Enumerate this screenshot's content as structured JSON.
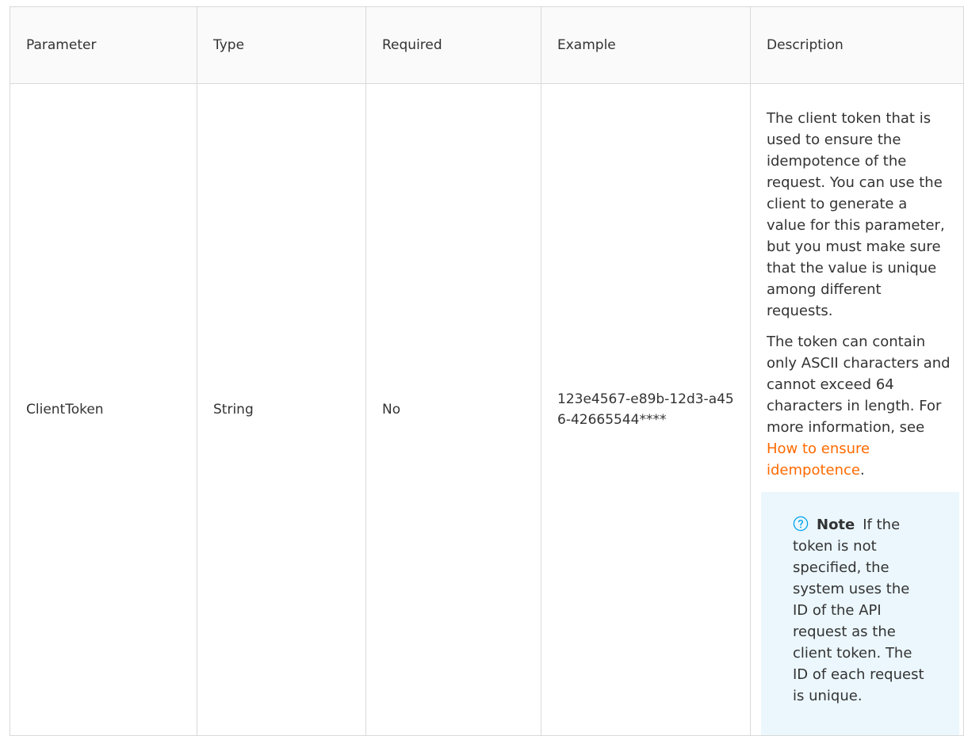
{
  "table": {
    "headers": {
      "parameter": "Parameter",
      "type": "Type",
      "required": "Required",
      "example": "Example",
      "description": "Description"
    },
    "rows": [
      {
        "parameter": "ClientToken",
        "type": "String",
        "required": "No",
        "example": "123e4567-e89b-12d3-a456-42665544****",
        "description": {
          "paragraph1": "The client token that is used to ensure the idempotence of the request. You can use the client to generate a value for this parameter, but you must make sure that the value is unique among different requests.",
          "paragraph2_prefix": "The token can contain only ASCII characters and cannot exceed 64 characters in length. For more information, see ",
          "paragraph2_link": "How to ensure idempotence",
          "paragraph2_suffix": ".",
          "note_label": "Note",
          "note_text": "If the token is not specified, the system uses the ID of the API request as the client token. The ID of each request is unique."
        }
      }
    ]
  },
  "colors": {
    "link": "#ff6a00",
    "note_background": "#ebf7fd",
    "note_icon": "#00a2ea",
    "border": "#d9d9d9",
    "header_background": "#fafafa",
    "text": "#333333"
  },
  "icons": {
    "note": "question-circle-icon"
  }
}
